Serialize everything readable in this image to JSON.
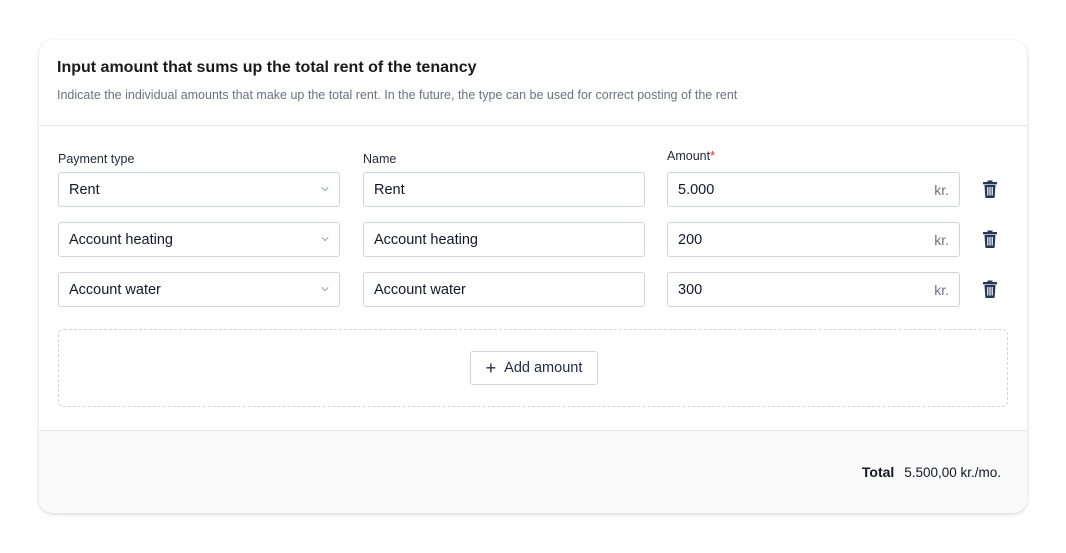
{
  "header": {
    "title": "Input amount that sums up the total rent of the tenancy",
    "subtitle": "Indicate the individual amounts that make up the total rent. In the future, the type can be used for correct posting of the rent"
  },
  "labels": {
    "payment_type": "Payment type",
    "name": "Name",
    "amount": "Amount",
    "required_mark": "*"
  },
  "rows": [
    {
      "payment_type": "Rent",
      "name": "Rent",
      "amount": "5.000",
      "suffix": "kr."
    },
    {
      "payment_type": "Account heating",
      "name": "Account heating",
      "amount": "200",
      "suffix": "kr."
    },
    {
      "payment_type": "Account water",
      "name": "Account water",
      "amount": "300",
      "suffix": "kr."
    }
  ],
  "actions": {
    "add_label": "Add amount",
    "add_icon": "plus-icon",
    "delete_icon": "trash-icon"
  },
  "footer": {
    "total_label": "Total",
    "total_value": "5.500,00 kr./mo."
  },
  "colors": {
    "accent": "#1f2a44",
    "required": "#dc2626"
  }
}
